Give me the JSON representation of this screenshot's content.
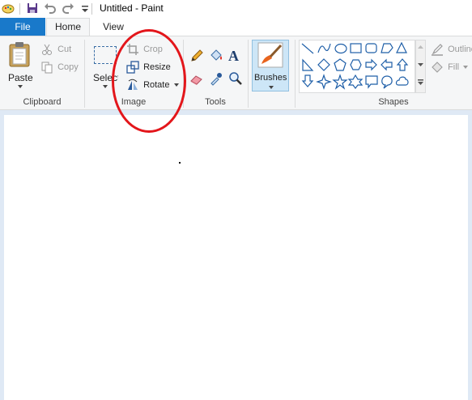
{
  "window": {
    "title": "Untitled - Paint"
  },
  "tabs": [
    {
      "label": "File"
    },
    {
      "label": "Home"
    },
    {
      "label": "View"
    }
  ],
  "clipboard": {
    "paste_label": "Paste",
    "cut_label": "Cut",
    "copy_label": "Copy",
    "group_label": "Clipboard"
  },
  "image": {
    "select_label": "Select",
    "crop_label": "Crop",
    "resize_label": "Resize",
    "rotate_label": "Rotate",
    "group_label": "Image"
  },
  "tools": {
    "group_label": "Tools"
  },
  "brushes": {
    "label": "Brushes"
  },
  "shapes": {
    "group_label": "Shapes",
    "outline_label": "Outline",
    "fill_label": "Fill"
  },
  "colors": {
    "accent": "#1979ca",
    "annotation": "#e3161b",
    "workspace": "#dfe9f5"
  }
}
